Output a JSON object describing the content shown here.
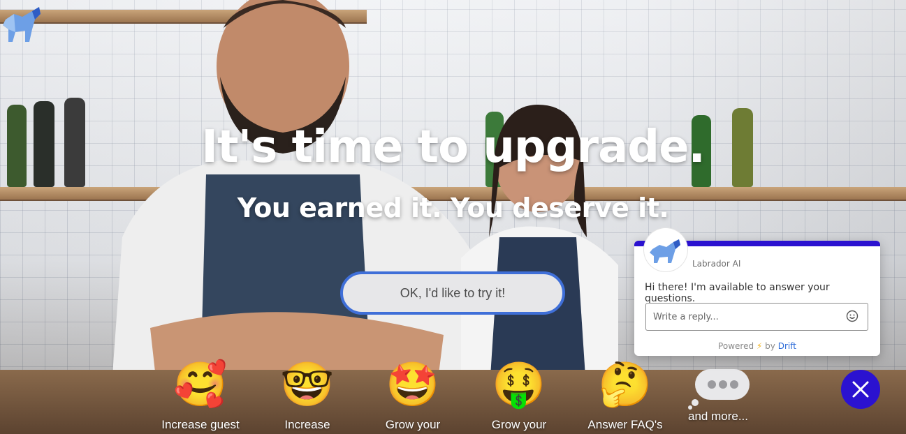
{
  "brand": {
    "logo_icon": "labrador-dog-logo-icon"
  },
  "hero": {
    "headline": "It's time to upgrade.",
    "subheadline": "You earned it. You deserve it.",
    "cta_label": "OK, I'd like to try it!"
  },
  "features": [
    {
      "icon": "smiling-face-with-hearts-icon",
      "emoji": "🥰",
      "label": "Increase guest"
    },
    {
      "icon": "nerd-face-icon",
      "emoji": "🤓",
      "label": "Increase"
    },
    {
      "icon": "star-struck-icon",
      "emoji": "🤩",
      "label": "Grow your"
    },
    {
      "icon": "money-mouth-face-icon",
      "emoji": "🤑",
      "label": "Grow your"
    },
    {
      "icon": "thinking-face-icon",
      "emoji": "🤔",
      "label": "Answer FAQ's"
    },
    {
      "icon": "thought-bubble-icon",
      "emoji": "",
      "label": "and more..."
    }
  ],
  "chat": {
    "bot_name": "Labrador AI",
    "message": "Hi there! I'm available to answer your questions.",
    "input_placeholder": "Write a reply...",
    "powered_prefix": "Powered",
    "powered_by": "by",
    "powered_brand": "Drift",
    "accent_color": "#2b12d0"
  },
  "close_button": {
    "icon": "close-icon"
  }
}
